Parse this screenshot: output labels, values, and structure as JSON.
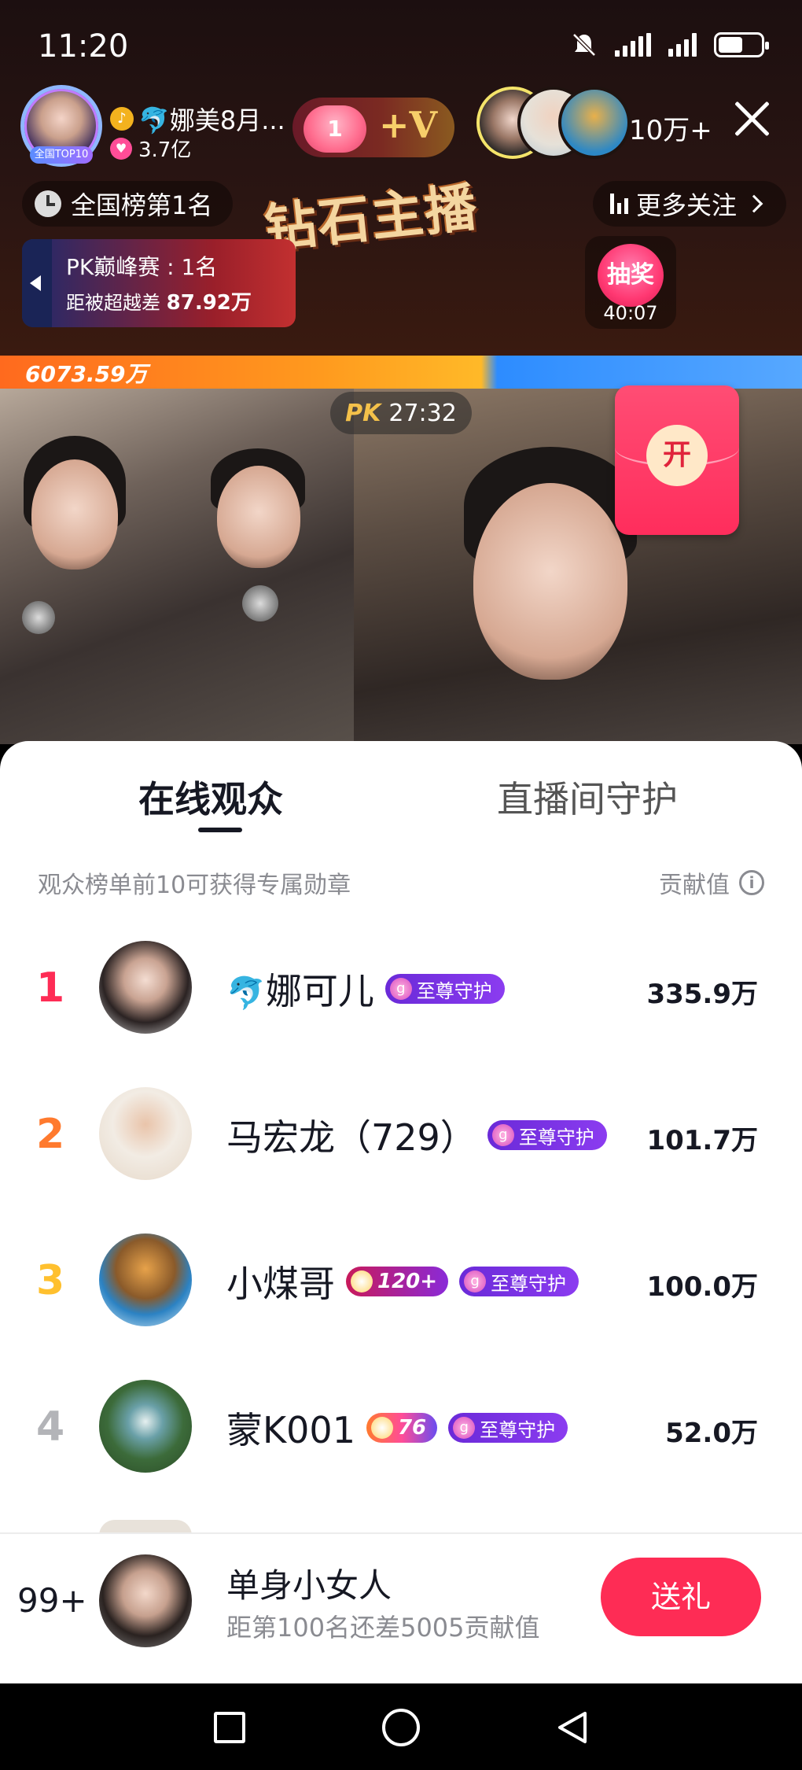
{
  "status_bar": {
    "time": "11:20"
  },
  "header": {
    "host_name": "🐬娜美8月...",
    "host_fans": "3.7亿",
    "host_badge": "全国TOP10",
    "heart_count": "1",
    "plus_v": "+V",
    "viewer_count": "10万+",
    "national_rank": "全国榜第1名",
    "diamond_title": "钻石主播",
    "more_follow": "更多关注",
    "pk_title": "PK巅峰赛 : 1名",
    "pk_gap_label": "距被超越差",
    "pk_gap_value": "87.92万",
    "lottery_label": "抽奖",
    "lottery_time": "40:07"
  },
  "pk": {
    "score_left": "6073.59万",
    "logo": "PK",
    "timer": "27:32",
    "red_packet_label": "开"
  },
  "sheet": {
    "tabs": [
      {
        "label": "在线观众",
        "active": true
      },
      {
        "label": "直播间守护",
        "active": false
      }
    ],
    "hint": "观众榜单前10可获得专属勋章",
    "contrib_label": "贡献值",
    "info_icon": "i",
    "guard_badge": "至尊守护",
    "rows": [
      {
        "rank": "1",
        "name": "娜可儿",
        "prefix": "🐬",
        "level": "",
        "score": "335.9万"
      },
      {
        "rank": "2",
        "name": "马宏龙（729）",
        "prefix": "",
        "level": "",
        "score": "101.7万"
      },
      {
        "rank": "3",
        "name": "小煤哥",
        "prefix": "",
        "level": "120+",
        "score": "100.0万"
      },
      {
        "rank": "4",
        "name": "蒙K001",
        "prefix": "",
        "level": "76",
        "score": "52.0万"
      }
    ]
  },
  "my_rank": {
    "position": "99+",
    "name": "单身小女人",
    "gap": "距第100名还差5005贡献值",
    "send_label": "送礼"
  },
  "colors": {
    "accent": "#fe2c55",
    "rank1": "#fe2c55",
    "rank2": "#ff7a2e",
    "rank3": "#ffc02e",
    "rank4": "#b3b4b8",
    "guard_badge": "#7a34e6"
  },
  "icons": [
    "mute-icon",
    "signal-icon",
    "battery-icon",
    "note-icon",
    "heart-icon",
    "close-icon",
    "clock-icon",
    "bars-icon",
    "chevron-right-icon",
    "back-arrow-icon",
    "info-icon",
    "recent-apps-icon",
    "home-icon",
    "back-icon"
  ]
}
